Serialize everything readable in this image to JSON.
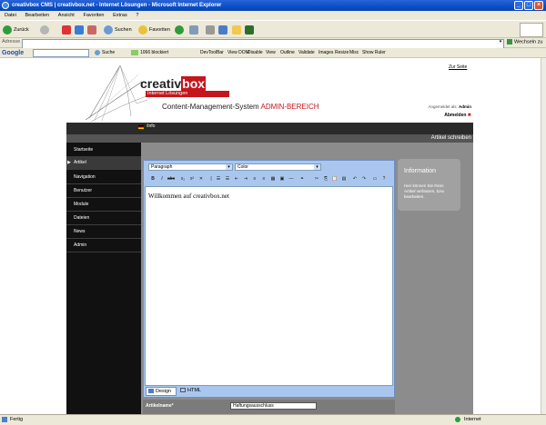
{
  "window": {
    "title": "creativbox CMS | creativbox.net - Internet Lösungen - Microsoft Internet Explorer"
  },
  "menu": [
    "Datei",
    "Bearbeiten",
    "Ansicht",
    "Favoriten",
    "Extras",
    "?"
  ],
  "toolbar": {
    "back": "Zurück",
    "search": "Suchen",
    "favorites": "Favoriten"
  },
  "addressbar": {
    "label": "Adresse",
    "go": "Wechseln zu",
    "value": ""
  },
  "googlebar": {
    "brand": "Google",
    "search": "Suche",
    "blocked": "1066 blockiert",
    "tools": [
      "DevToolBar",
      "View DOM",
      "Disable",
      "View",
      "Outline",
      "Validate",
      "Images",
      "Resize",
      "Misc",
      "Show Ruler"
    ]
  },
  "site": {
    "back_link": "Zur Seite",
    "logo": {
      "name_a": "creativ",
      "name_b": "box",
      "tagline": "Internet Lösungen"
    },
    "heading_a": "Content-Management-System",
    "heading_b": "ADMIN-BEREICH",
    "logged_in_label": "Angemeldet als:",
    "logged_in_user": "Admin",
    "logout": "Abmelden",
    "lang_info": "Info",
    "section_title": "Artikel schreiben",
    "nav": [
      "Startseite",
      "Artikel",
      "Navigation",
      "Benutzer",
      "Module",
      "Dateien",
      "News",
      "Admin"
    ],
    "editor": {
      "format": "Paragraph",
      "color": "Color",
      "content": "Willkommen auf creativbox.net",
      "tab_design": "Design",
      "tab_html": "HTML"
    },
    "info": {
      "title": "Information",
      "text": "Hier können Sie Ihren Artikel verfassen, bzw. bearbeiten."
    },
    "field": {
      "label": "Artikelname*",
      "value": "Haftungsausschluss"
    }
  },
  "statusbar": {
    "left": "Fertig",
    "right": "Internet"
  }
}
